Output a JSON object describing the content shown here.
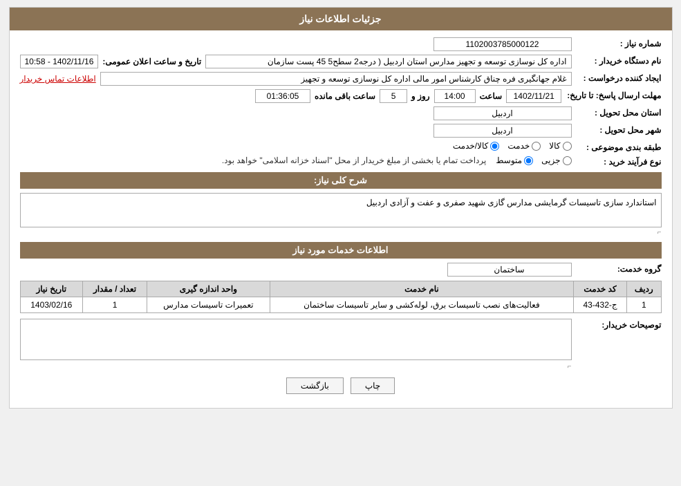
{
  "page": {
    "title": "جزئیات اطلاعات نیاز"
  },
  "header": {
    "title": "جزئیات اطلاعات نیاز"
  },
  "fields": {
    "shomareNiaz_label": "شماره نیاز :",
    "shomareNiaz_value": "1102003785000122",
    "namDastgah_label": "نام دستگاه خریدار :",
    "namDastgah_value": "اداره کل نوسازی   توسعه و تجهیز مدارس استان اردبیل ( درجه2  سطح5  45  پست سازمان",
    "ijadKonande_label": "ایجاد کننده درخواست :",
    "ijadKonande_value": "غلام جهانگیری فره چناق کارشناس امور مالی اداره کل نوسازی   توسعه و تجهیز",
    "ettelaatTamas_label": "اطلاعات تماس خریدار",
    "mohlatErsalPasokh_label": "مهلت ارسال پاسخ: تا تاریخ:",
    "tarikh_value": "1402/11/21",
    "saat_label": "ساعت",
    "saat_value": "14:00",
    "roz_label": "روز و",
    "roz_value": "5",
    "baghi_label": "ساعت باقی مانده",
    "baghi_value": "01:36:05",
    "tarikh_va_saat_label": "تاریخ و ساعت اعلان عمومی:",
    "tarikh_va_saat_value": "1402/11/16 - 10:58",
    "ostan_label": "استان محل تحویل :",
    "ostan_value": "اردبیل",
    "shahr_label": "شهر محل تحویل :",
    "shahr_value": "اردبیل",
    "tabaqebandi_label": "طبقه بندی موضوعی :",
    "tabaqebandi_options": [
      {
        "label": "کالا",
        "selected": false
      },
      {
        "label": "خدمت",
        "selected": false
      },
      {
        "label": "کالا/خدمت",
        "selected": false
      }
    ],
    "tabaqebandi_selected": "کالا/خدمت",
    "noeFarayand_label": "نوع فرآیند خرید :",
    "noeFarayand_options": [
      {
        "label": "جزیی",
        "selected": false
      },
      {
        "label": "متوسط",
        "selected": false
      }
    ],
    "noeFarayand_selected": "متوسط",
    "noeFarayand_note": "پرداخت تمام یا بخشی از مبلغ خریدار از محل \"اسناد خزانه اسلامی\" خواهد بود.",
    "sharhKolli_label": "شرح کلی نیاز:",
    "sharhKolli_value": "استاندارد سازی تاسیسات گرمایشی مدارس گازی شهید صفری و عفت و آزادی اردبیل",
    "khadamat_section": "اطلاعات خدمات مورد نیاز",
    "grohKhadamat_label": "گروه خدمت:",
    "grohKhadamat_value": "ساختمان",
    "table": {
      "headers": [
        "ردیف",
        "کد خدمت",
        "نام خدمت",
        "واحد اندازه گیری",
        "تعداد / مقدار",
        "تاریخ نیاز"
      ],
      "rows": [
        {
          "radif": "1",
          "kodKhadamat": "ج-432-43",
          "namKhadamat": "فعالیت‌های نصب تاسیسات برق، لوله‌کشی و سایر تاسیسات ساختمان",
          "vahed": "تعمیرات تاسیسات مدارس",
          "tedad": "1",
          "tarikh": "1403/02/16"
        }
      ]
    },
    "tosiyatKharidar_label": "توصیحات خریدار:",
    "tosiyatKharidar_value": "",
    "btn_chap": "چاپ",
    "btn_bazgasht": "بازگشت"
  }
}
